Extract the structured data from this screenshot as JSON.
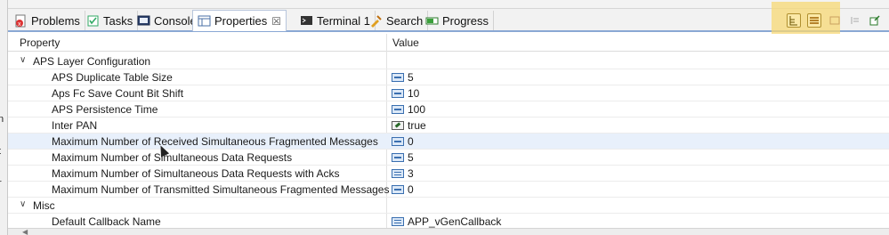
{
  "gutter": [
    "n",
    "t",
    "r"
  ],
  "tabs": [
    {
      "label": "Problems",
      "icon": "problems-icon"
    },
    {
      "label": "Tasks",
      "icon": "tasks-icon"
    },
    {
      "label": "Console",
      "icon": "console-icon"
    },
    {
      "label": "Properties",
      "icon": "properties-icon",
      "active": true,
      "close": "☒"
    },
    {
      "label": "Terminal 1",
      "icon": "terminal-icon"
    },
    {
      "label": "Search",
      "icon": "search-icon"
    },
    {
      "label": "Progress",
      "icon": "progress-icon"
    }
  ],
  "table": {
    "col_property": "Property",
    "col_value": "Value",
    "groups": [
      {
        "label": "APS Layer Configuration",
        "rows": [
          {
            "name": "APS Duplicate Table Size",
            "value": "5",
            "icon": "field-icon"
          },
          {
            "name": "Aps Fc Save Count Bit Shift",
            "value": "10",
            "icon": "field-icon"
          },
          {
            "name": "APS Persistence Time",
            "value": "100",
            "icon": "field-icon"
          },
          {
            "name": "Inter PAN",
            "value": "true",
            "icon": "checkbox-icon"
          },
          {
            "name": "Maximum Number of Received Simultaneous Fragmented Messages",
            "value": "0",
            "icon": "field-icon",
            "selected": true
          },
          {
            "name": "Maximum Number of Simultaneous Data Requests",
            "value": "5",
            "icon": "field-icon"
          },
          {
            "name": "Maximum Number of Simultaneous Data Requests with Acks",
            "value": "3",
            "icon": "list-icon"
          },
          {
            "name": "Maximum Number of Transmitted Simultaneous Fragmented Messages",
            "value": "0",
            "icon": "field-icon"
          }
        ]
      },
      {
        "label": "Misc",
        "rows": [
          {
            "name": "Default Callback Name",
            "value": "APP_vGenCallback",
            "icon": "list-icon"
          }
        ]
      }
    ]
  },
  "toolbar": {
    "buttons": [
      "show-categories-icon",
      "show-advanced-icon",
      "filter-icon",
      "restore-default-icon",
      "pin-icon"
    ]
  },
  "colors": {
    "highlight": "#f7d874",
    "selected_row": "#e8f0fb",
    "tab_underline": "#8aa8d4"
  }
}
